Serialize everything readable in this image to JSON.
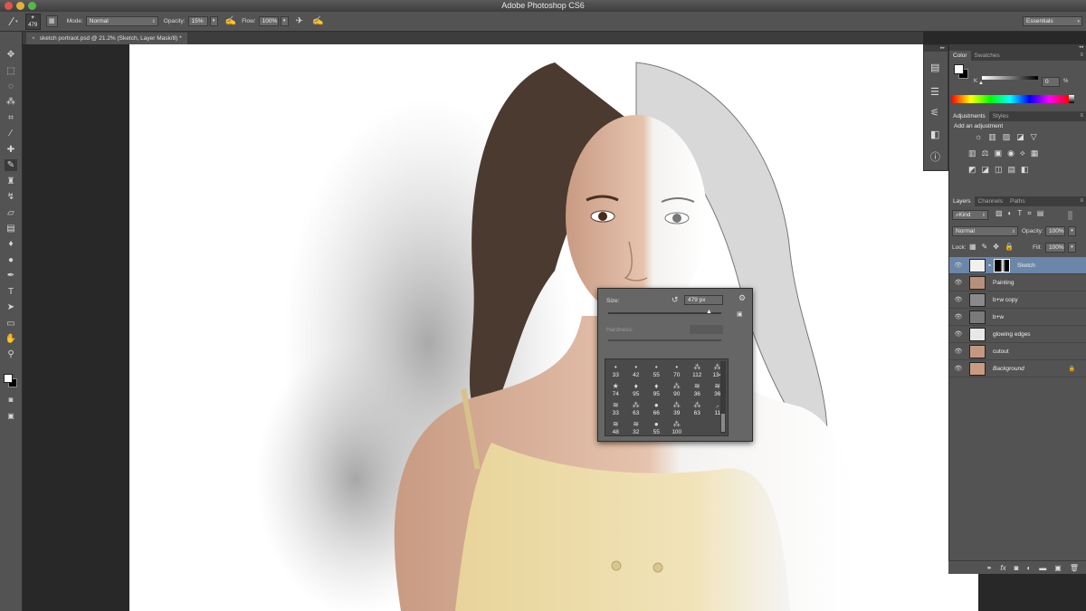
{
  "app_title": "Adobe Photoshop CS6",
  "options_bar": {
    "brush_size": "479",
    "mode_label": "Mode:",
    "mode_value": "Normal",
    "opacity_label": "Opacity:",
    "opacity_value": "15%",
    "flow_label": "Flow:",
    "flow_value": "100%",
    "workspace": "Essentials"
  },
  "document_tab": "sketch portraot.psd @ 21.2% (Sketch, Layer Mask/8) *",
  "color_panel": {
    "tabs": [
      "Color",
      "Swatches"
    ],
    "channel": "K",
    "value": "0",
    "unit": "%"
  },
  "adjustments_panel": {
    "tabs": [
      "Adjustments",
      "Styles"
    ],
    "heading": "Add an adjustment"
  },
  "layers_panel": {
    "tabs": [
      "Layers",
      "Channels",
      "Paths"
    ],
    "filter": "Kind",
    "blend_mode": "Normal",
    "opacity_label": "Opacity:",
    "opacity_value": "100%",
    "lock_label": "Lock:",
    "fill_label": "Fill:",
    "fill_value": "100%",
    "layers": [
      {
        "name": "Sketch",
        "selected": true
      },
      {
        "name": "Painting"
      },
      {
        "name": "b+w copy"
      },
      {
        "name": "b+w"
      },
      {
        "name": "glowing edges"
      },
      {
        "name": "cutout"
      },
      {
        "name": "Background",
        "italic": true
      }
    ]
  },
  "brush_popup": {
    "size_label": "Size:",
    "size_value": "479 px",
    "hardness_label": "Hardness:",
    "presets": [
      "33",
      "42",
      "55",
      "70",
      "112",
      "134",
      "74",
      "95",
      "95",
      "90",
      "36",
      "36",
      "33",
      "63",
      "66",
      "39",
      "63",
      "11",
      "48",
      "32",
      "55",
      "100"
    ]
  },
  "colors": {
    "ui_dark": "#282828",
    "panel": "#535353",
    "selected_layer": "#6a86a8"
  }
}
